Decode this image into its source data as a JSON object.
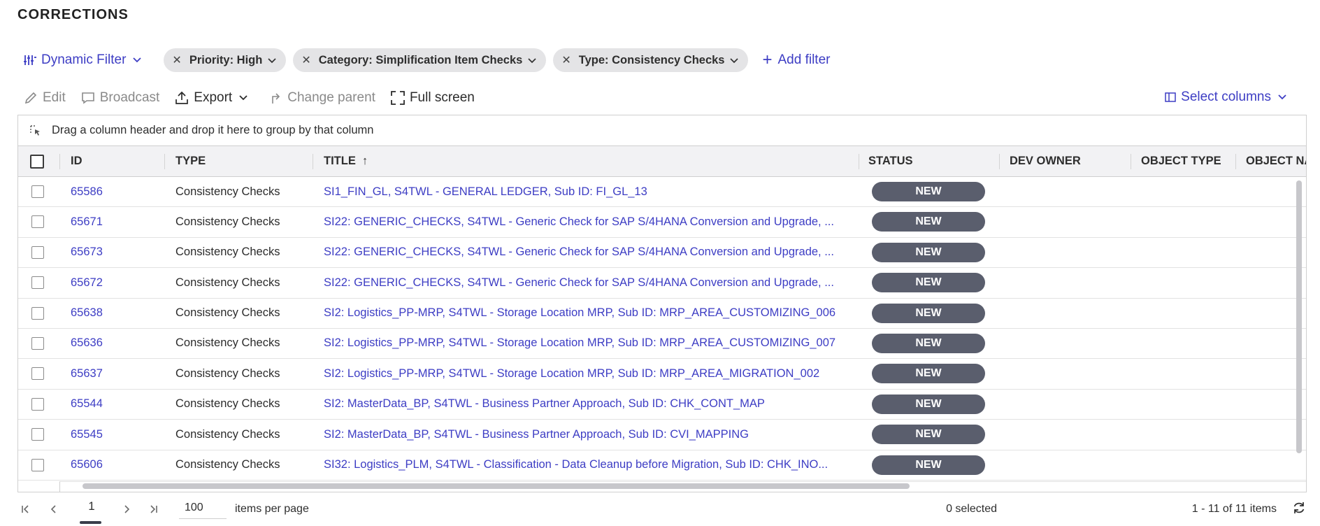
{
  "page_title": "CORRECTIONS",
  "filters": {
    "dynamic_filter_label": "Dynamic Filter",
    "chips": [
      {
        "label": "Priority: High"
      },
      {
        "label": "Category: Simplification Item Checks"
      },
      {
        "label": "Type: Consistency Checks"
      }
    ],
    "add_filter_label": "Add filter"
  },
  "toolbar": {
    "edit_label": "Edit",
    "broadcast_label": "Broadcast",
    "export_label": "Export",
    "change_parent_label": "Change parent",
    "full_screen_label": "Full screen",
    "select_columns_label": "Select columns"
  },
  "grid": {
    "group_hint": "Drag a column header and drop it here to group by that column",
    "columns": [
      "ID",
      "TYPE",
      "TITLE",
      "STATUS",
      "DEV OWNER",
      "OBJECT TYPE",
      "OBJECT NA"
    ],
    "sort_indicator": "↑",
    "rows": [
      {
        "id": "65586",
        "type": "Consistency Checks",
        "title": "SI1_FIN_GL, S4TWL - GENERAL LEDGER, Sub ID: FI_GL_13",
        "status": "NEW"
      },
      {
        "id": "65671",
        "type": "Consistency Checks",
        "title": "SI22: GENERIC_CHECKS, S4TWL - Generic Check for SAP S/4HANA Conversion and Upgrade, ...",
        "status": "NEW"
      },
      {
        "id": "65673",
        "type": "Consistency Checks",
        "title": "SI22: GENERIC_CHECKS, S4TWL - Generic Check for SAP S/4HANA Conversion and Upgrade, ...",
        "status": "NEW"
      },
      {
        "id": "65672",
        "type": "Consistency Checks",
        "title": "SI22: GENERIC_CHECKS, S4TWL - Generic Check for SAP S/4HANA Conversion and Upgrade, ...",
        "status": "NEW"
      },
      {
        "id": "65638",
        "type": "Consistency Checks",
        "title": "SI2: Logistics_PP-MRP, S4TWL - Storage Location MRP, Sub ID: MRP_AREA_CUSTOMIZING_006",
        "status": "NEW"
      },
      {
        "id": "65636",
        "type": "Consistency Checks",
        "title": "SI2: Logistics_PP-MRP, S4TWL - Storage Location MRP, Sub ID: MRP_AREA_CUSTOMIZING_007",
        "status": "NEW"
      },
      {
        "id": "65637",
        "type": "Consistency Checks",
        "title": "SI2: Logistics_PP-MRP, S4TWL - Storage Location MRP, Sub ID: MRP_AREA_MIGRATION_002",
        "status": "NEW"
      },
      {
        "id": "65544",
        "type": "Consistency Checks",
        "title": "SI2: MasterData_BP, S4TWL - Business Partner Approach, Sub ID: CHK_CONT_MAP",
        "status": "NEW"
      },
      {
        "id": "65545",
        "type": "Consistency Checks",
        "title": "SI2: MasterData_BP, S4TWL - Business Partner Approach, Sub ID: CVI_MAPPING",
        "status": "NEW"
      },
      {
        "id": "65606",
        "type": "Consistency Checks",
        "title": "SI32: Logistics_PLM, S4TWL - Classification - Data Cleanup before Migration, Sub ID: CHK_INO...",
        "status": "NEW"
      }
    ]
  },
  "pagination": {
    "current_page": "1",
    "items_per_page": "100",
    "items_per_page_label": "items per page",
    "selected_text": "0 selected",
    "range_text": "1 - 11 of 11 items"
  },
  "colors": {
    "accent": "#3d3dc4",
    "status_pill": "#5a5e6d"
  }
}
